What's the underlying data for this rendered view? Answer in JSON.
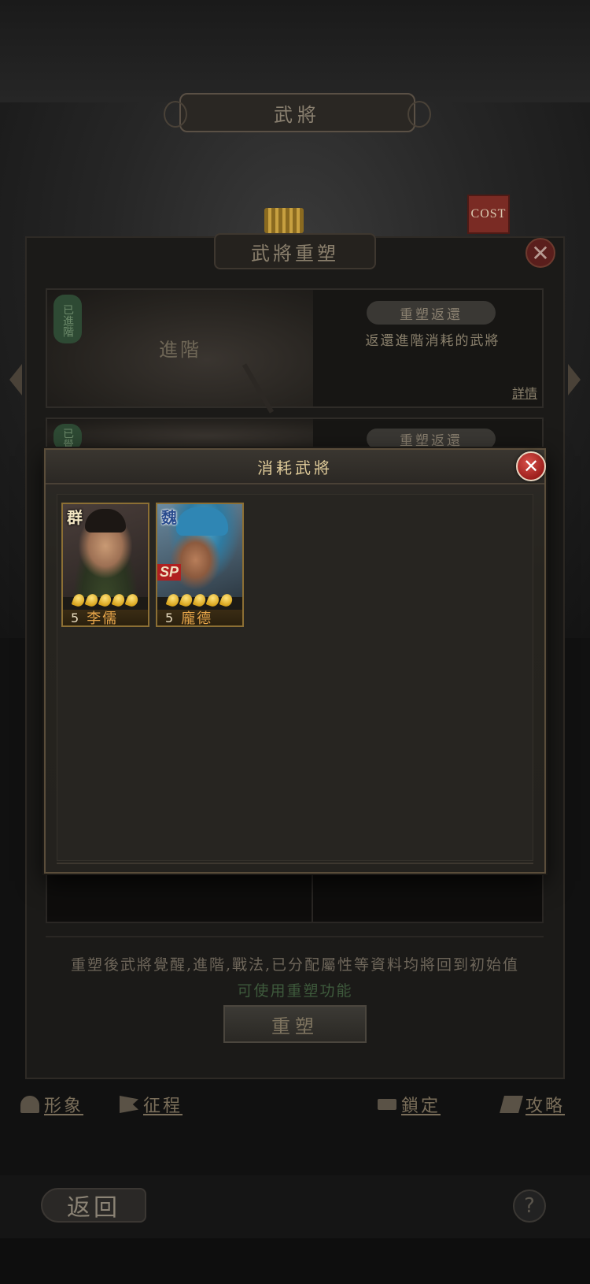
{
  "top_title": "武將",
  "cost_flag": "COST",
  "reshape_panel": {
    "title": "武將重塑",
    "close_label": "✕",
    "entries": [
      {
        "badge": "已進階",
        "type": "進階",
        "pill": "重塑返還",
        "description": "返還進階消耗的武將",
        "detail": "詳情"
      },
      {
        "badge": "已覺",
        "pill": "重塑返還"
      }
    ],
    "notice": "重塑後武將覺醒,進階,戰法,已分配屬性等資料均將回到初始值",
    "status": "可使用重塑功能",
    "button_label": "重塑"
  },
  "bottom_menu": {
    "image": "形象",
    "journey": "征程",
    "lock": "鎖定",
    "guide": "攻略"
  },
  "back_label": "返回",
  "help_label": "?",
  "modal": {
    "title": "消耗武將",
    "close_label": "✕",
    "generals": [
      {
        "faction": "群",
        "cost": "5",
        "name": "李儒",
        "stars": 5,
        "sp": ""
      },
      {
        "faction": "魏",
        "cost": "5",
        "name": "龐德",
        "stars": 5,
        "sp": "SP"
      }
    ]
  },
  "colors": {
    "accent_gold": "#e0cc9a",
    "close_red": "#9d1f1c",
    "name_orange": "#e8a64a",
    "card_border": "#8c6f34"
  }
}
